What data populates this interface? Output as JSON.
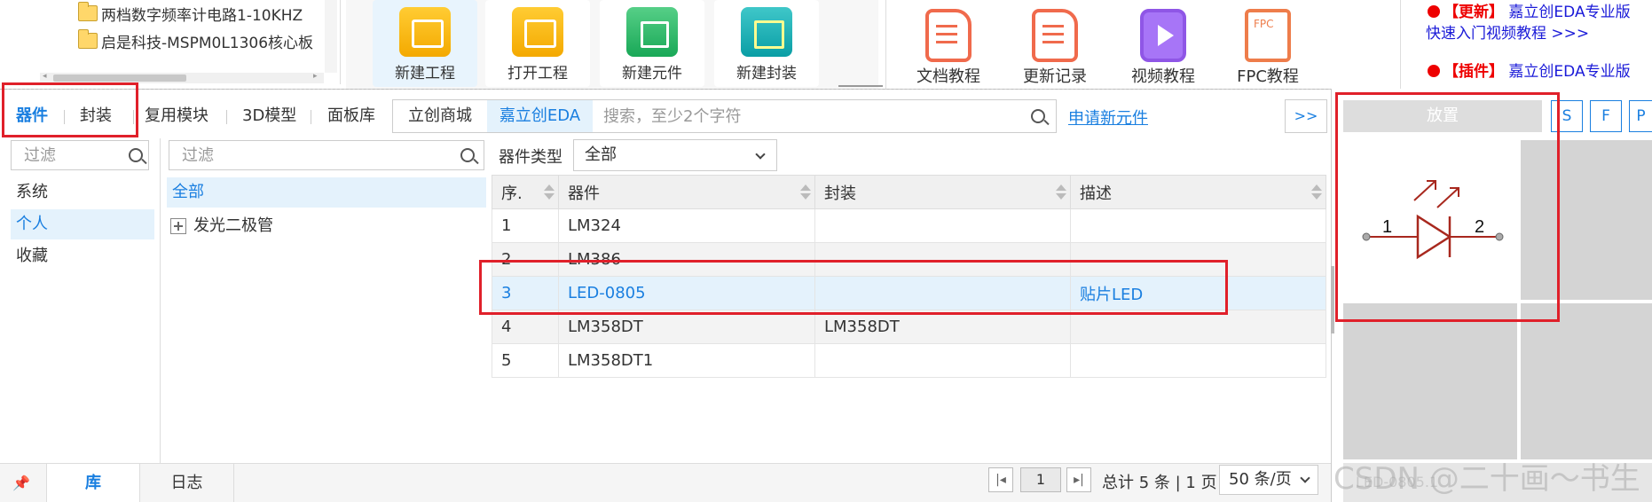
{
  "file_tree": {
    "items": [
      "两档数字频率计电路1-10KHZ",
      "启是科技-MSPM0L1306核心板"
    ]
  },
  "quick_actions": [
    {
      "label": "新建工程",
      "icon": "folder-icon"
    },
    {
      "label": "打开工程",
      "icon": "folder-icon"
    },
    {
      "label": "新建元件",
      "icon": "component-icon"
    },
    {
      "label": "新建封装",
      "icon": "chip-icon"
    }
  ],
  "docs": [
    {
      "label": "文档教程",
      "icon": "document-icon"
    },
    {
      "label": "更新记录",
      "icon": "document-icon"
    },
    {
      "label": "视频教程",
      "icon": "video-icon"
    },
    {
      "label": "FPC教程",
      "icon": "fpc-icon"
    }
  ],
  "news": [
    {
      "tag": "【更新】",
      "text": "嘉立创EDA专业版",
      "sub": "快速入门视频教程 >>>"
    },
    {
      "tag": "【插件】",
      "text": "嘉立创EDA专业版",
      "sub": ""
    }
  ],
  "left_tabs": [
    "器件",
    "封装"
  ],
  "tabs": [
    "复用模块",
    "3D模型",
    "面板库"
  ],
  "sources": [
    "立创商城",
    "嘉立创EDA"
  ],
  "search": {
    "placeholder": "搜索，至少2个字符"
  },
  "apply_link": "申请新元件",
  "more": ">>",
  "category_filter": {
    "placeholder": "过滤"
  },
  "categories": [
    "系统",
    "个人",
    "收藏"
  ],
  "tree_filter": {
    "placeholder": "过滤"
  },
  "tree": {
    "all": "全部",
    "node": "发光二极管"
  },
  "device_type": {
    "label": "器件类型",
    "value": "全部"
  },
  "table": {
    "headers": [
      "序.",
      "器件",
      "封装",
      "描述"
    ],
    "rows": [
      [
        "1",
        "LM324",
        "",
        ""
      ],
      [
        "2",
        "LM386",
        "",
        ""
      ],
      [
        "3",
        "LED-0805",
        "",
        "贴片LED"
      ],
      [
        "4",
        "LM358DT",
        "LM358DT",
        ""
      ],
      [
        "5",
        "LM358DT1",
        "",
        ""
      ]
    ],
    "selected_row": 3
  },
  "bottom_tabs": [
    "库",
    "日志"
  ],
  "pagination": {
    "page": "1",
    "total": "总计 5 条 | 1 页",
    "page_size": "50 条/页"
  },
  "right": {
    "place_label": "放置",
    "buttons": [
      "S",
      "F",
      "P"
    ],
    "pin1": "1",
    "pin2": "2",
    "preview_label": "LED-0805.1",
    "watermark": "CSDN @二十画～书生"
  },
  "colors": {
    "accent": "#1a7fe0",
    "highlight": "#e0202a",
    "led": "#a8281e"
  }
}
